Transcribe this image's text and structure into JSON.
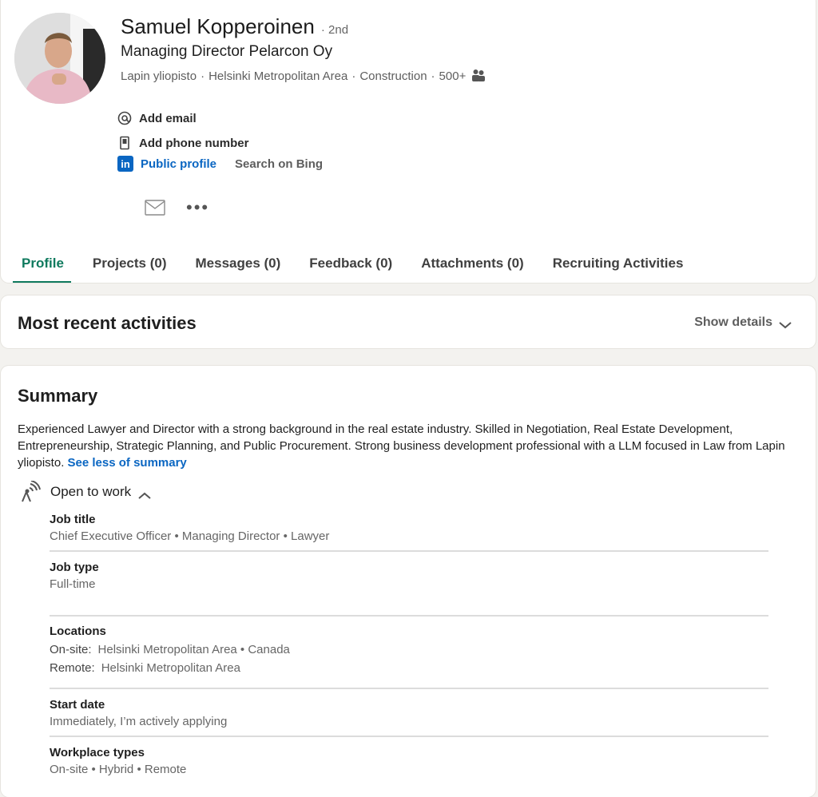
{
  "profile": {
    "name": "Samuel Kopperoinen",
    "degree": "· 2nd",
    "headline": "Managing Director Pelarcon Oy",
    "school": "Lapin yliopisto",
    "location": "Helsinki Metropolitan Area",
    "industry": "Construction",
    "connections": "500+",
    "add_email": "Add email",
    "add_phone": "Add phone number",
    "public_profile": "Public profile",
    "search_bing": "Search on Bing",
    "more": "•••"
  },
  "tabs": [
    {
      "label": "Profile"
    },
    {
      "label": "Projects (0)"
    },
    {
      "label": "Messages (0)"
    },
    {
      "label": "Feedback (0)"
    },
    {
      "label": "Attachments (0)"
    },
    {
      "label": "Recruiting Activities"
    }
  ],
  "activities": {
    "title": "Most recent activities",
    "show_details": "Show details"
  },
  "summary": {
    "title": "Summary",
    "text": "Experienced Lawyer and Director with a strong background in the real estate industry. Skilled in Negotiation, Real Estate Development, Entrepreneurship, Strategic Planning, and Public Procurement. Strong business development professional with a LLM focused in Law from Lapin yliopisto.",
    "see_less": "See less of summary",
    "open_to_work": "Open to work",
    "job_title_label": "Job title",
    "job_title_value": "Chief Executive Officer • Managing Director • Lawyer",
    "job_type_label": "Job type",
    "job_type_value": "Full-time",
    "locations_label": "Locations",
    "onsite_key": "On-site:",
    "onsite_value": "Helsinki Metropolitan Area •  Canada",
    "remote_key": "Remote:",
    "remote_value": "Helsinki Metropolitan Area",
    "start_date_label": "Start date",
    "start_date_value": "Immediately, I’m actively applying",
    "workplace_label": "Workplace types",
    "workplace_value": "On-site • Hybrid • Remote"
  },
  "colors": {
    "accent_green": "#0f7a5e",
    "link_blue": "#0a66c2"
  }
}
